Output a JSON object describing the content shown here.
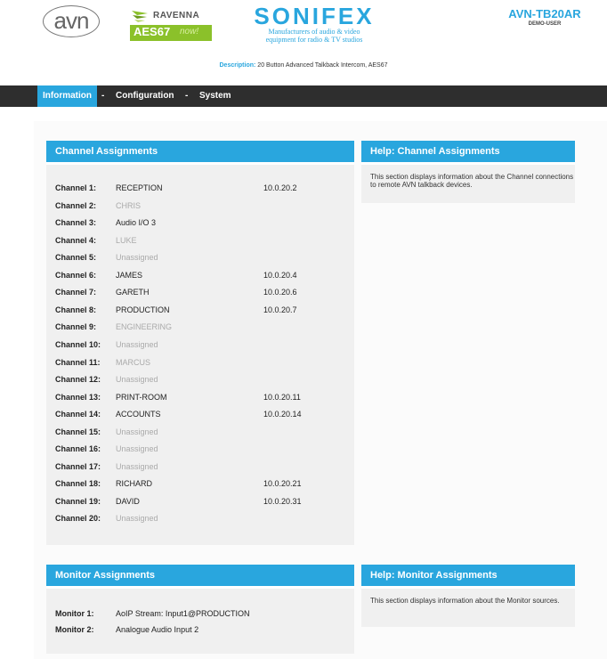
{
  "header": {
    "avn_logo": "avn",
    "ravenna": "RAVENNA",
    "aes67": "AES67",
    "aes67_now": "now!",
    "brand": "SONIFEX",
    "tagline_1": "Manufacturers of audio & video",
    "tagline_2": "equipment for radio & TV studios",
    "model": "AVN-TB20AR",
    "user": "DEMO-USER",
    "description_label": "Description:",
    "description": "20 Button Advanced Talkback Intercom, AES67"
  },
  "nav": {
    "items": [
      "Information",
      "Configuration",
      "System"
    ],
    "separator": "-",
    "active": "Information"
  },
  "channel_panel": {
    "title": "Channel Assignments",
    "channels": [
      {
        "label": "Channel 1:",
        "name": "RECEPTION",
        "ip": "10.0.20.2",
        "state": "on"
      },
      {
        "label": "Channel 2:",
        "name": "CHRIS",
        "ip": "",
        "state": "off"
      },
      {
        "label": "Channel 3:",
        "name": "Audio I/O 3",
        "ip": "",
        "state": "on"
      },
      {
        "label": "Channel 4:",
        "name": "LUKE",
        "ip": "",
        "state": "off"
      },
      {
        "label": "Channel 5:",
        "name": "Unassigned",
        "ip": "",
        "state": "off"
      },
      {
        "label": "Channel 6:",
        "name": "JAMES",
        "ip": "10.0.20.4",
        "state": "on"
      },
      {
        "label": "Channel 7:",
        "name": "GARETH",
        "ip": "10.0.20.6",
        "state": "on"
      },
      {
        "label": "Channel 8:",
        "name": "PRODUCTION",
        "ip": "10.0.20.7",
        "state": "on"
      },
      {
        "label": "Channel 9:",
        "name": "ENGINEERING",
        "ip": "",
        "state": "off"
      },
      {
        "label": "Channel 10:",
        "name": "Unassigned",
        "ip": "",
        "state": "off"
      },
      {
        "label": "Channel 11:",
        "name": "MARCUS",
        "ip": "",
        "state": "off"
      },
      {
        "label": "Channel 12:",
        "name": "Unassigned",
        "ip": "",
        "state": "off"
      },
      {
        "label": "Channel 13:",
        "name": "PRINT-ROOM",
        "ip": "10.0.20.11",
        "state": "on"
      },
      {
        "label": "Channel 14:",
        "name": "ACCOUNTS",
        "ip": "10.0.20.14",
        "state": "on"
      },
      {
        "label": "Channel 15:",
        "name": "Unassigned",
        "ip": "",
        "state": "off"
      },
      {
        "label": "Channel 16:",
        "name": "Unassigned",
        "ip": "",
        "state": "off"
      },
      {
        "label": "Channel 17:",
        "name": "Unassigned",
        "ip": "",
        "state": "off"
      },
      {
        "label": "Channel 18:",
        "name": "RICHARD",
        "ip": "10.0.20.21",
        "state": "on"
      },
      {
        "label": "Channel 19:",
        "name": "DAVID",
        "ip": "10.0.20.31",
        "state": "on"
      },
      {
        "label": "Channel 20:",
        "name": "Unassigned",
        "ip": "",
        "state": "off"
      }
    ]
  },
  "channel_help": {
    "title": "Help: Channel Assignments",
    "text": "This section displays information about the Channel connections to remote AVN talkback devices."
  },
  "monitor_panel": {
    "title": "Monitor Assignments",
    "monitors": [
      {
        "label": "Monitor 1:",
        "value": "AoIP Stream: Input1@PRODUCTION"
      },
      {
        "label": "Monitor 2:",
        "value": "Analogue Audio Input 2"
      }
    ]
  },
  "monitor_help": {
    "title": "Help: Monitor Assignments",
    "text": "This section displays information about the Monitor sources."
  },
  "colors": {
    "accent": "#29a6de",
    "navbar": "#2e2e2e",
    "panel": "#f0f0f0",
    "aes67": "#8bc12a",
    "inactive_text": "#aaaaaa"
  }
}
